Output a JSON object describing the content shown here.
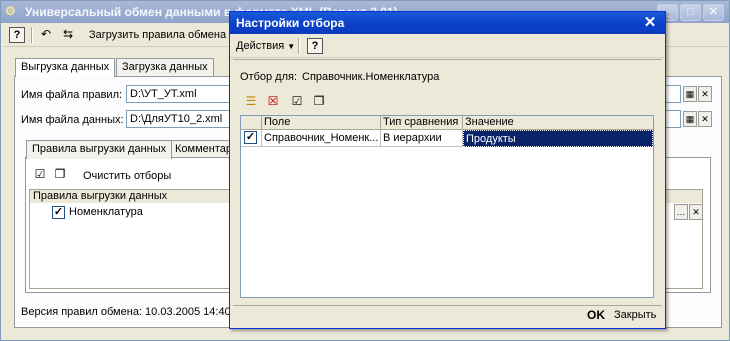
{
  "main_window": {
    "title": "Универсальный обмен данными в формате XML (Версия 2.01)",
    "window_buttons": {
      "minimize": "_",
      "maximize": "□",
      "close": "✕"
    },
    "toolbar": {
      "load_rules_label": "Загрузить правила обмена"
    },
    "tabs": [
      "Выгрузка данных",
      "Загрузка данных"
    ],
    "rules_file": {
      "label": "Имя файла правил:",
      "value": "D:\\УТ_УТ.xml"
    },
    "data_file": {
      "label": "Имя файла данных:",
      "value": "D:\\ДляУТ10_2.xml"
    },
    "subtabs": [
      "Правила выгрузки данных",
      "Комментарий"
    ],
    "clear_filters_label": "Очистить отборы",
    "tree": {
      "header": "Правила выгрузки данных",
      "item": "Номенклатура"
    },
    "version_text": "Версия правил обмена:  10.03.2005 14:40"
  },
  "dialog": {
    "title": "Настройки отбора",
    "menu": {
      "actions_label": "Действия",
      "help_label": "?"
    },
    "filter_for": {
      "label": "Отбор для:",
      "value": "Справочник.Номенклатура"
    },
    "table": {
      "columns": [
        "",
        "Поле",
        "Тип сравнения",
        "Значение"
      ],
      "rows": [
        {
          "checked": true,
          "field": "Справочник_Номенк...",
          "comparison": "В иерархии",
          "value": "Продукты"
        }
      ]
    },
    "ok_label": "OK",
    "close_label": "Закрыть"
  },
  "colors": {
    "dialog_title": "#0b3cbe",
    "selection": "#0a246a",
    "window_bg": "#ece9d8"
  }
}
